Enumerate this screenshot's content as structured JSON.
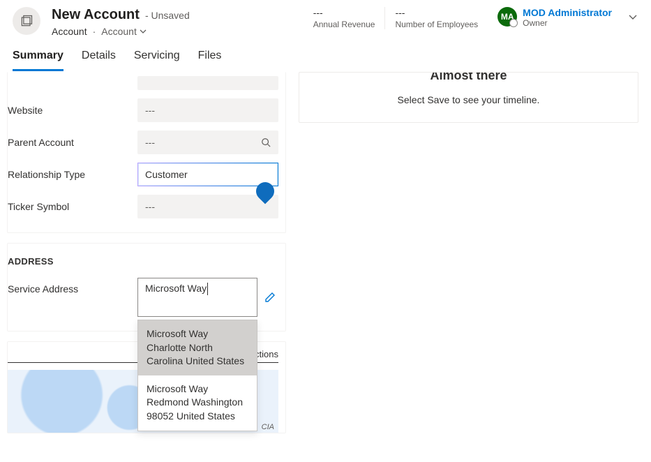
{
  "header": {
    "title": "New Account",
    "status": "- Unsaved",
    "entity": "Account",
    "entity_view": "Account"
  },
  "meta": {
    "revenue_value": "---",
    "revenue_label": "Annual Revenue",
    "employees_value": "---",
    "employees_label": "Number of Employees",
    "owner_initials": "MA",
    "owner_name": "MOD Administrator",
    "owner_role": "Owner"
  },
  "tabs": {
    "summary": "Summary",
    "details": "Details",
    "servicing": "Servicing",
    "files": "Files"
  },
  "fields": {
    "website_label": "Website",
    "website_value": "---",
    "parent_label": "Parent Account",
    "parent_value": "---",
    "relationship_label": "Relationship Type",
    "relationship_value": "Customer",
    "ticker_label": "Ticker Symbol",
    "ticker_value": "---"
  },
  "address": {
    "section": "ADDRESS",
    "label": "Service Address",
    "input_value": "Microsoft Way",
    "suggestions": [
      "Microsoft Way Charlotte North Carolina United States",
      "Microsoft Way Redmond Washington 98052 United States"
    ]
  },
  "map": {
    "directions": "ctions",
    "attrib": "CIA"
  },
  "timeline": {
    "title": "Almost there",
    "subtitle": "Select Save to see your timeline."
  }
}
